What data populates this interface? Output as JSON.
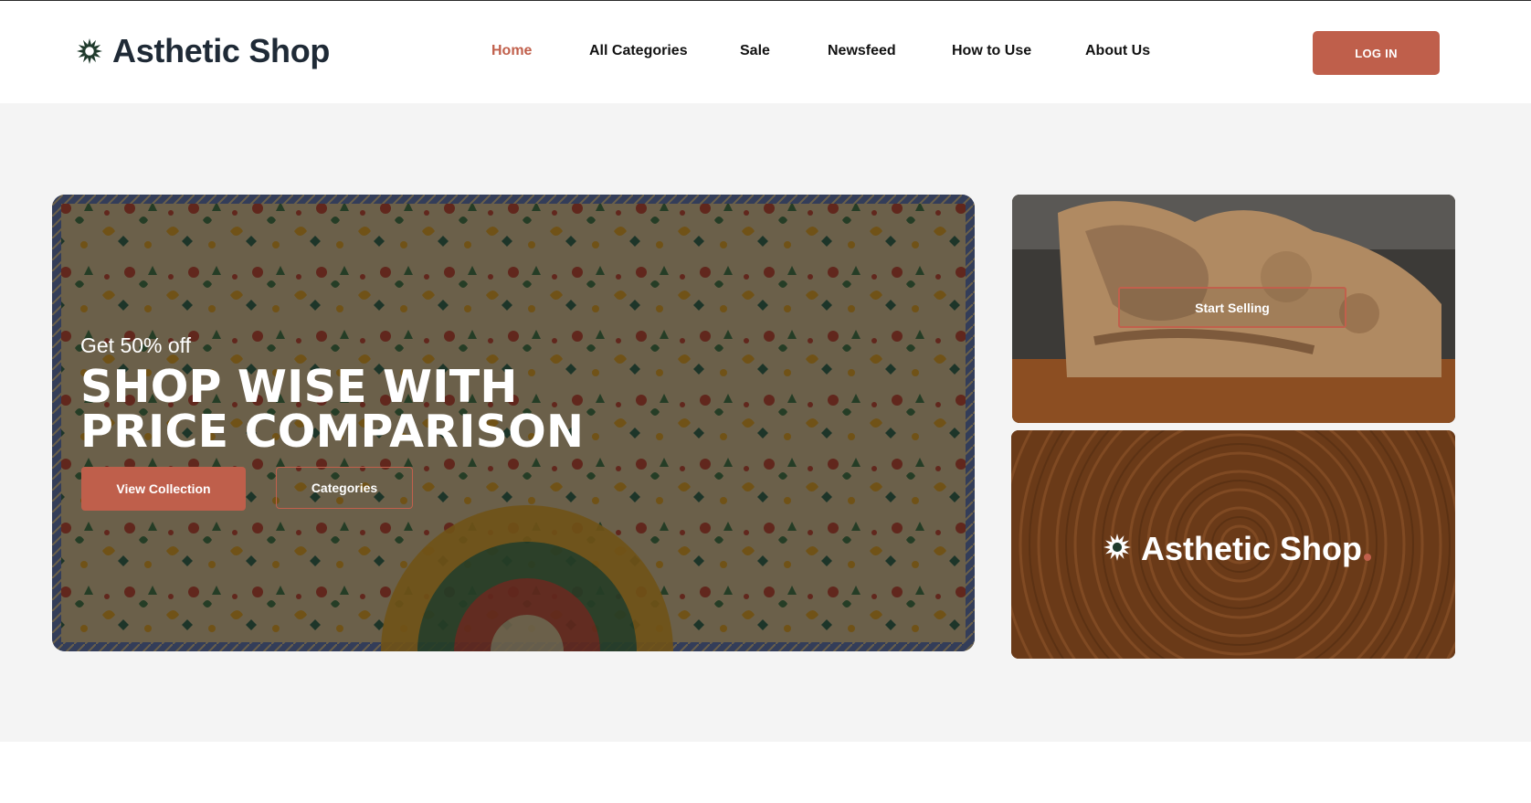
{
  "brand": {
    "name": "Asthetic Shop",
    "icon": "sun-flower-icon"
  },
  "nav": {
    "items": [
      {
        "label": "Home",
        "active": true
      },
      {
        "label": "All Categories",
        "active": false
      },
      {
        "label": "Sale",
        "active": false
      },
      {
        "label": "Newsfeed",
        "active": false
      },
      {
        "label": "How to Use",
        "active": false
      },
      {
        "label": "About Us",
        "active": false
      }
    ],
    "login_label": "LOG IN"
  },
  "hero": {
    "promo": "Get 50% off",
    "headline": "SHOP WISE WITH PRICE COMPARISON",
    "primary_button": "View Collection",
    "secondary_button": "Categories"
  },
  "side_cards": {
    "top": {
      "button_label": "Start Selling"
    },
    "bottom": {
      "brand_name": "Asthetic Shop"
    }
  },
  "colors": {
    "accent": "#bf5f4b",
    "brand_text": "#1f2a36",
    "hero_background": "#f4f4f4"
  }
}
